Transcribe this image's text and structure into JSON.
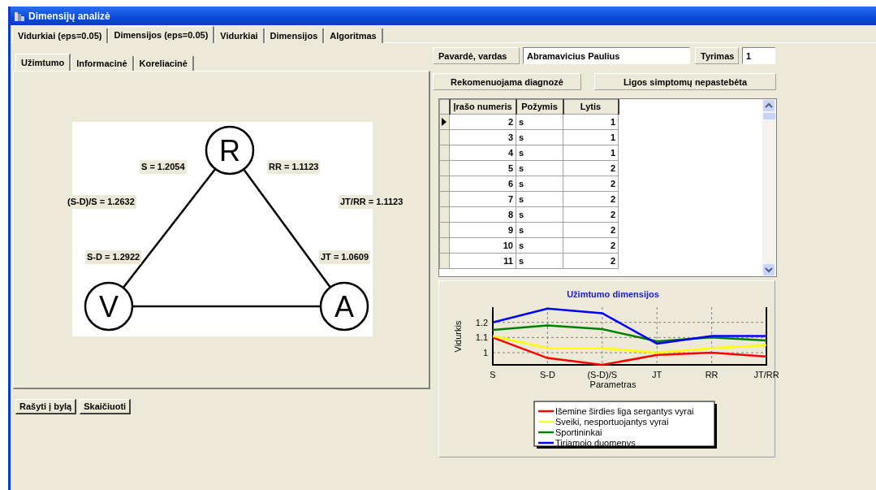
{
  "window": {
    "title": "Dimensijų analizė"
  },
  "tabs": [
    {
      "label": "Vidurkiai (eps=0.05)",
      "selected": false
    },
    {
      "label": "Dimensijos (eps=0.05)",
      "selected": true
    },
    {
      "label": "Vidurkiai",
      "selected": false
    },
    {
      "label": "Dimensijos",
      "selected": false
    },
    {
      "label": "Algoritmas",
      "selected": false
    }
  ],
  "inner_tabs": [
    {
      "label": "Užimtumo",
      "selected": true
    },
    {
      "label": "Informacinė",
      "selected": false
    },
    {
      "label": "Koreliacinė",
      "selected": false
    }
  ],
  "diagram": {
    "nodes": [
      {
        "label": "R"
      },
      {
        "label": "V"
      },
      {
        "label": "A"
      }
    ],
    "edge_labels": [
      {
        "text": "S = 1.2054"
      },
      {
        "text": "RR = 1.1123"
      },
      {
        "text": "(S-D)/S = 1.2632"
      },
      {
        "text": "JT/RR = 1.1123"
      },
      {
        "text": "S-D = 1.2922"
      },
      {
        "text": "JT = 1.0609"
      }
    ]
  },
  "buttons": [
    "Rašyti į bylą",
    "Skaičiuoti"
  ],
  "patient": {
    "name_label": "Pavardė, vardas",
    "name_value": "Abramavicius Paulius",
    "study_label": "Tyrimas",
    "study_value": "1"
  },
  "diagnosis": {
    "label": "Rekomenuojama diagnozė",
    "value": "Ligos simptomų nepastebėta"
  },
  "table": {
    "columns": [
      "Įrašo numeris",
      "Požymis",
      "Lytis"
    ],
    "rows": [
      {
        "cells": [
          "2",
          "s",
          "1"
        ],
        "selected": true
      },
      {
        "cells": [
          "3",
          "s",
          "1"
        ],
        "selected": false
      },
      {
        "cells": [
          "4",
          "s",
          "1"
        ],
        "selected": false
      },
      {
        "cells": [
          "5",
          "s",
          "2"
        ],
        "selected": false
      },
      {
        "cells": [
          "6",
          "s",
          "2"
        ],
        "selected": false
      },
      {
        "cells": [
          "7",
          "s",
          "2"
        ],
        "selected": false
      },
      {
        "cells": [
          "8",
          "s",
          "2"
        ],
        "selected": false
      },
      {
        "cells": [
          "9",
          "s",
          "2"
        ],
        "selected": false
      },
      {
        "cells": [
          "10",
          "s",
          "2"
        ],
        "selected": false
      },
      {
        "cells": [
          "11",
          "s",
          "2"
        ],
        "selected": false
      }
    ]
  },
  "chart": {
    "chart_data": {
      "type": "line",
      "title": "Užimtumo dimensijos",
      "xlabel": "Parametras",
      "ylabel": "Vidurkis",
      "categories": [
        "S",
        "S-D",
        "(S-D)/S",
        "JT",
        "RR",
        "JT/RR"
      ],
      "ylim": [
        0.92,
        1.3
      ],
      "yticks": [
        1,
        1.1,
        1.2
      ],
      "grid": true,
      "legend": true,
      "series": [
        {
          "name": "Išemine širdies liga sergantys vyrai",
          "color": "#ff0000",
          "values": [
            1.1,
            0.965,
            0.92,
            0.985,
            1.0,
            0.975
          ]
        },
        {
          "name": "Sveiki, nesportuojantys vyrai",
          "color": "#ffff00",
          "values": [
            1.11,
            1.03,
            1.03,
            1.0,
            1.03,
            1.05
          ]
        },
        {
          "name": "Sportininkai",
          "color": "#008000",
          "values": [
            1.15,
            1.18,
            1.155,
            1.075,
            1.1,
            1.08
          ]
        },
        {
          "name": "Tiriamojo duomenys",
          "color": "#0000ff",
          "values": [
            1.2,
            1.29,
            1.26,
            1.06,
            1.11,
            1.11
          ]
        }
      ]
    }
  }
}
